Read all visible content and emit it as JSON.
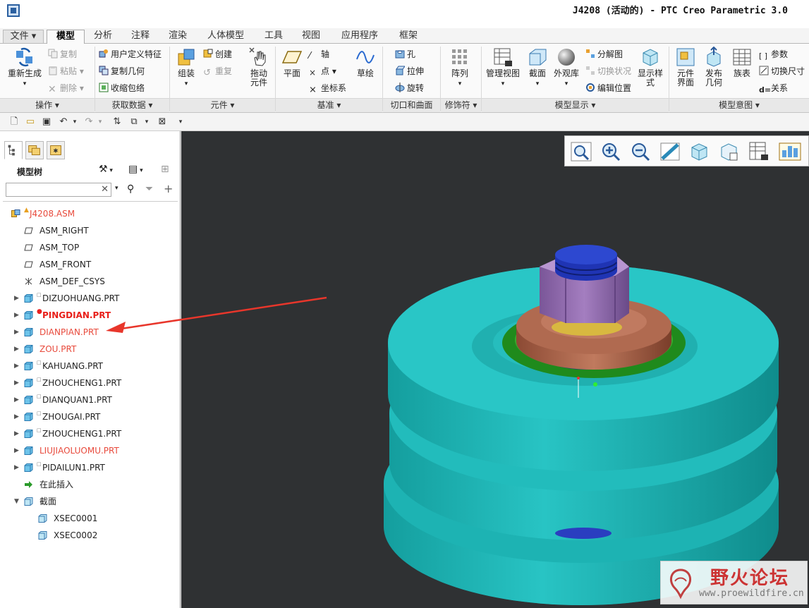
{
  "title": "J4208 (活动的) - PTC Creo Parametric 3.0",
  "tabs": [
    "文件",
    "模型",
    "分析",
    "注释",
    "渲染",
    "人体模型",
    "工具",
    "视图",
    "应用程序",
    "框架"
  ],
  "ribbon": {
    "operations": {
      "regenerate": "重新生成",
      "copy": "复制",
      "paste": "粘贴",
      "delete": "删除",
      "group": "操作"
    },
    "get_data": {
      "udf": "用户定义特征",
      "copy_geom": "复制几何",
      "shrinkwrap": "收缩包络",
      "group": "获取数据"
    },
    "component": {
      "assemble": "组装",
      "create": "创建",
      "repeat": "重复",
      "drag_line1": "拖动",
      "drag_line2": "元件",
      "group": "元件"
    },
    "datum": {
      "plane": "平面",
      "axis": "轴",
      "point": "点",
      "csys": "坐标系",
      "sketch": "草绘",
      "group": "基准"
    },
    "cut_surface": {
      "hole": "孔",
      "extrude": "拉伸",
      "revolve": "旋转",
      "group": "切口和曲面"
    },
    "modifiers": {
      "pattern": "阵列",
      "group": "修饰符"
    },
    "model_display": {
      "manage_views": "管理视图",
      "section": "截面",
      "appearance": "外观库",
      "explode": "分解图",
      "toggle_status": "切换状况",
      "edit_position": "编辑位置",
      "display_style_line1": "显示样",
      "display_style_line2": "式",
      "group": "模型显示"
    },
    "model_intent": {
      "comp_if_line1": "元件",
      "comp_if_line2": "界面",
      "publish_line1": "发布",
      "publish_line2": "几何",
      "family_table": "族表",
      "params": "参数",
      "switch_dims": "切换尺寸",
      "relations": "关系",
      "group": "模型意图"
    }
  },
  "panel": {
    "title": "模型树"
  },
  "tree": [
    {
      "label": "J4208.ASM",
      "style": "red",
      "icon": "assembly-icon",
      "expander": "",
      "flag": "▲",
      "indent": 0
    },
    {
      "label": "ASM_RIGHT",
      "style": "normal",
      "icon": "datum-plane-icon",
      "expander": "",
      "flag": "",
      "indent": 1
    },
    {
      "label": "ASM_TOP",
      "style": "normal",
      "icon": "datum-plane-icon",
      "expander": "",
      "flag": "",
      "indent": 1
    },
    {
      "label": "ASM_FRONT",
      "style": "normal",
      "icon": "datum-plane-icon",
      "expander": "",
      "flag": "",
      "indent": 1
    },
    {
      "label": "ASM_DEF_CSYS",
      "style": "normal",
      "icon": "csys-icon",
      "expander": "",
      "flag": "",
      "indent": 1
    },
    {
      "label": "DIZUOHUANG.PRT",
      "style": "normal",
      "icon": "part-icon",
      "expander": "▶",
      "flag": "□",
      "indent": 1
    },
    {
      "label": "PINGDIAN.PRT",
      "style": "redbold",
      "icon": "part-icon",
      "expander": "▶",
      "flag": "●",
      "indent": 1
    },
    {
      "label": "DIANPIAN.PRT",
      "style": "red",
      "icon": "part-icon",
      "expander": "▶",
      "flag": "",
      "indent": 1
    },
    {
      "label": "ZOU.PRT",
      "style": "red",
      "icon": "part-icon",
      "expander": "▶",
      "flag": "",
      "indent": 1
    },
    {
      "label": "KAHUANG.PRT",
      "style": "normal",
      "icon": "part-icon",
      "expander": "▶",
      "flag": "□",
      "indent": 1
    },
    {
      "label": "ZHOUCHENG1.PRT",
      "style": "normal",
      "icon": "part-icon",
      "expander": "▶",
      "flag": "□",
      "indent": 1
    },
    {
      "label": "DIANQUAN1.PRT",
      "style": "normal",
      "icon": "part-icon",
      "expander": "▶",
      "flag": "□",
      "indent": 1
    },
    {
      "label": "ZHOUGAI.PRT",
      "style": "normal",
      "icon": "part-icon",
      "expander": "▶",
      "flag": "□",
      "indent": 1
    },
    {
      "label": "ZHOUCHENG1.PRT",
      "style": "normal",
      "icon": "part-icon",
      "expander": "▶",
      "flag": "□",
      "indent": 1
    },
    {
      "label": "LIUJIAOLUOMU.PRT",
      "style": "red",
      "icon": "part-icon",
      "expander": "▶",
      "flag": "",
      "indent": 1
    },
    {
      "label": "PIDAILUN1.PRT",
      "style": "normal",
      "icon": "part-icon",
      "expander": "▶",
      "flag": "□",
      "indent": 1
    },
    {
      "label": "在此插入",
      "style": "normal",
      "icon": "insert-here-icon",
      "expander": "",
      "flag": "",
      "indent": 1
    },
    {
      "label": "截面",
      "style": "normal",
      "icon": "section-folder-icon",
      "expander": "▼",
      "flag": "",
      "indent": 1
    },
    {
      "label": "XSEC0001",
      "style": "normal",
      "icon": "xsec-icon",
      "expander": "",
      "flag": "",
      "indent": 2
    },
    {
      "label": "XSEC0002",
      "style": "normal",
      "icon": "xsec-icon",
      "expander": "",
      "flag": "",
      "indent": 2
    }
  ],
  "watermark": {
    "main": "野火论坛",
    "sub": "www.proewildfire.cn"
  },
  "colors": {
    "viewport_bg": "#2f3133",
    "pulley": "#1fbcbc",
    "nut": "#9b72b6",
    "washer": "#b66a4e",
    "ring": "#2aa028",
    "bolt": "#2a3ec0",
    "arrow": "#e8362b"
  }
}
